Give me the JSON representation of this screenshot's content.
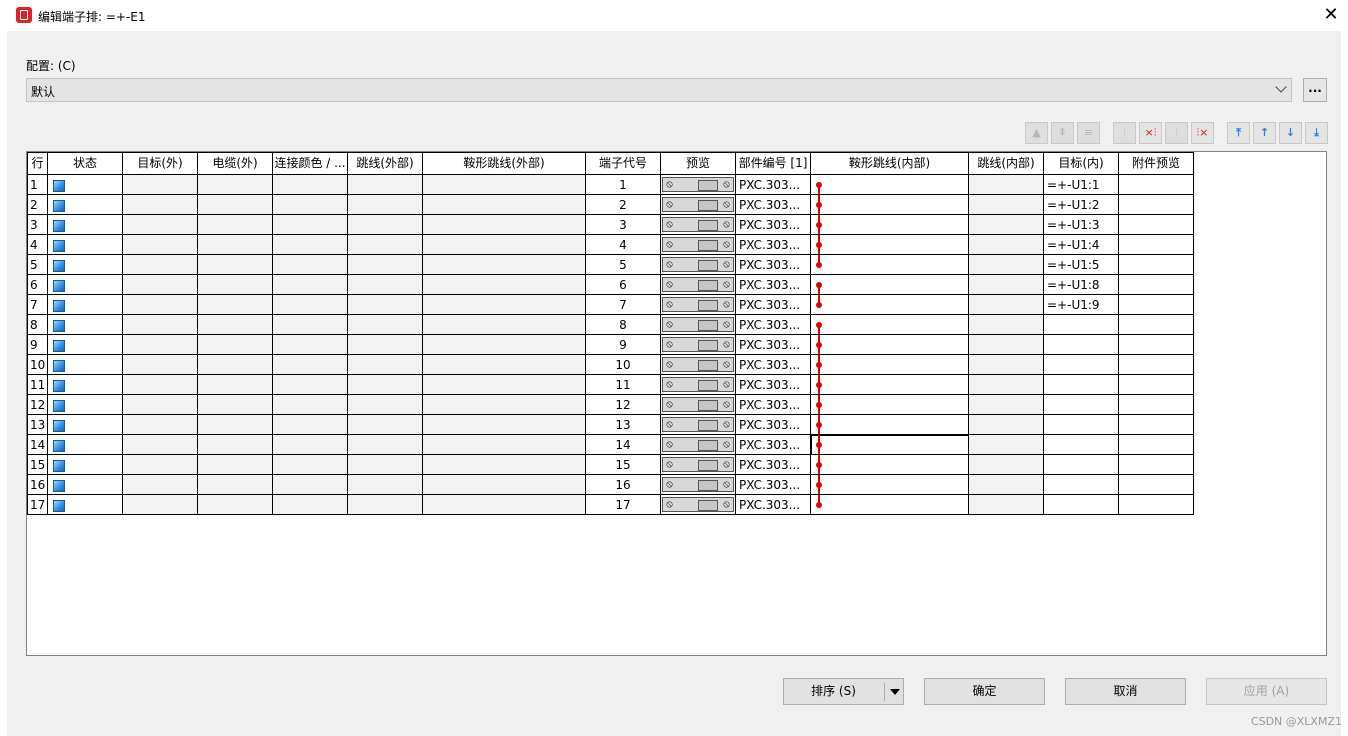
{
  "window": {
    "title": "编辑端子排: =+-E1",
    "close_glyph": "✕"
  },
  "config": {
    "label": "配置: (C)",
    "value": "默认",
    "more_label": "..."
  },
  "toolbar": [
    {
      "name": "move-group-up-icon",
      "glyph": "▲",
      "state": "disabled"
    },
    {
      "name": "move-group-top-icon",
      "glyph": "⇞",
      "state": "disabled"
    },
    {
      "name": "align-center-icon",
      "glyph": "≡",
      "state": "disabled"
    },
    {
      "name": "jumper-icon",
      "glyph": "⫶",
      "state": "disabled"
    },
    {
      "name": "add-jumper-icon",
      "glyph": "×⫶",
      "state": "red"
    },
    {
      "name": "jumper-gray-icon",
      "glyph": "⫶",
      "state": "disabled"
    },
    {
      "name": "remove-jumper-icon",
      "glyph": "⫶×",
      "state": "red"
    },
    {
      "name": "move-top-icon",
      "glyph": "⤒",
      "state": "blue"
    },
    {
      "name": "move-up-icon",
      "glyph": "↑",
      "state": "blue"
    },
    {
      "name": "move-down-icon",
      "glyph": "↓",
      "state": "blue"
    },
    {
      "name": "move-bottom-icon",
      "glyph": "⤓",
      "state": "blue"
    }
  ],
  "columns": [
    "行",
    "状态",
    "目标(外)",
    "电缆(外)",
    "连接颜色 / ...",
    "跳线(外部)",
    "鞍形跳线(外部)",
    "端子代号",
    "预览",
    "部件编号 [1]",
    "鞍形跳线(内部)",
    "跳线(内部)",
    "目标(内)",
    "附件预览"
  ],
  "rows": [
    {
      "row": "1",
      "terminal": "1",
      "part": "PXC.303...",
      "target_in": "=+-U1:1"
    },
    {
      "row": "2",
      "terminal": "2",
      "part": "PXC.303...",
      "target_in": "=+-U1:2"
    },
    {
      "row": "3",
      "terminal": "3",
      "part": "PXC.303...",
      "target_in": "=+-U1:3"
    },
    {
      "row": "4",
      "terminal": "4",
      "part": "PXC.303...",
      "target_in": "=+-U1:4"
    },
    {
      "row": "5",
      "terminal": "5",
      "part": "PXC.303...",
      "target_in": "=+-U1:5"
    },
    {
      "row": "6",
      "terminal": "6",
      "part": "PXC.303...",
      "target_in": "=+-U1:8"
    },
    {
      "row": "7",
      "terminal": "7",
      "part": "PXC.303...",
      "target_in": "=+-U1:9"
    },
    {
      "row": "8",
      "terminal": "8",
      "part": "PXC.303...",
      "target_in": ""
    },
    {
      "row": "9",
      "terminal": "9",
      "part": "PXC.303...",
      "target_in": ""
    },
    {
      "row": "10",
      "terminal": "10",
      "part": "PXC.303...",
      "target_in": ""
    },
    {
      "row": "11",
      "terminal": "11",
      "part": "PXC.303...",
      "target_in": ""
    },
    {
      "row": "12",
      "terminal": "12",
      "part": "PXC.303...",
      "target_in": ""
    },
    {
      "row": "13",
      "terminal": "13",
      "part": "PXC.303...",
      "target_in": ""
    },
    {
      "row": "14",
      "terminal": "14",
      "part": "PXC.303...",
      "target_in": ""
    },
    {
      "row": "15",
      "terminal": "15",
      "part": "PXC.303...",
      "target_in": ""
    },
    {
      "row": "16",
      "terminal": "16",
      "part": "PXC.303...",
      "target_in": ""
    },
    {
      "row": "17",
      "terminal": "17",
      "part": "PXC.303...",
      "target_in": ""
    }
  ],
  "jumper_groups": [
    [
      1,
      5
    ],
    [
      6,
      7
    ],
    [
      8,
      17
    ]
  ],
  "selected_row": 14,
  "buttons": {
    "sort": "排序 (S)",
    "ok": "确定",
    "cancel": "取消",
    "apply": "应用 (A)"
  },
  "watermark": "CSDN @XLXMZ1"
}
